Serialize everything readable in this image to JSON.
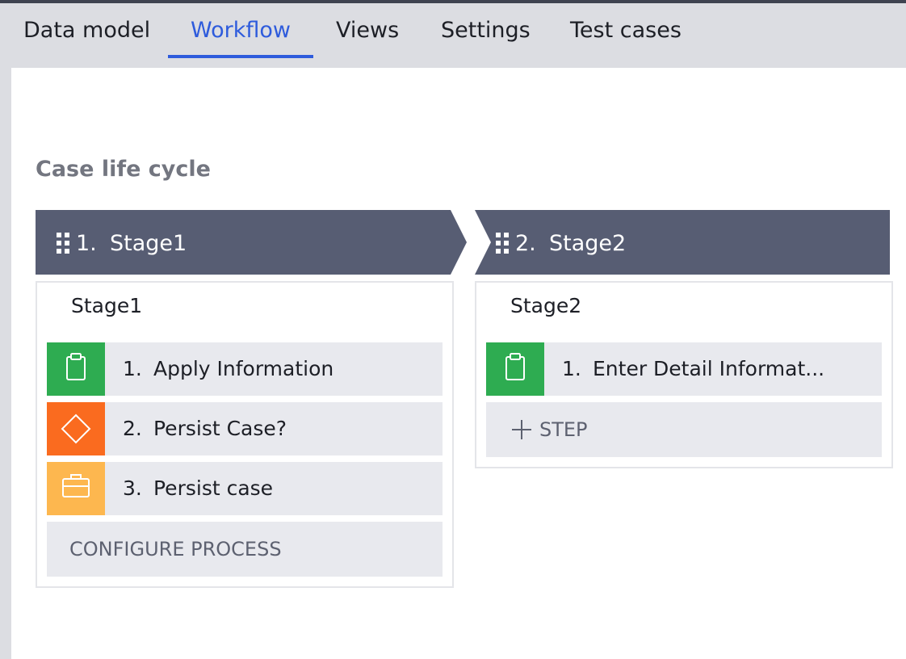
{
  "tabs": [
    {
      "label": "Data model",
      "active": false
    },
    {
      "label": "Workflow",
      "active": true
    },
    {
      "label": "Views",
      "active": false
    },
    {
      "label": "Settings",
      "active": false
    },
    {
      "label": "Test cases",
      "active": false
    }
  ],
  "section_title": "Case life cycle",
  "stages": [
    {
      "number": "1.",
      "name": "Stage1",
      "box_label": "Stage1",
      "steps": [
        {
          "number": "1.",
          "label": "Apply Information",
          "icon": "clipboard-icon",
          "color": "#2eac51"
        },
        {
          "number": "2.",
          "label": "Persist Case?",
          "icon": "decision-diamond-icon",
          "color": "#fa6b1f"
        },
        {
          "number": "3.",
          "label": "Persist case",
          "icon": "briefcase-icon",
          "color": "#fdb74f"
        }
      ],
      "action_label": "CONFIGURE PROCESS"
    },
    {
      "number": "2.",
      "name": "Stage2",
      "box_label": "Stage2",
      "steps": [
        {
          "number": "1.",
          "label": "Enter Detail Informat...",
          "icon": "clipboard-icon",
          "color": "#2eac51"
        }
      ],
      "action_label": "STEP",
      "action_icon": "plus-icon"
    }
  ],
  "colors": {
    "stage_header": "#575d73",
    "accent": "#2e5bdc",
    "step_background": "#e8e9ee"
  }
}
